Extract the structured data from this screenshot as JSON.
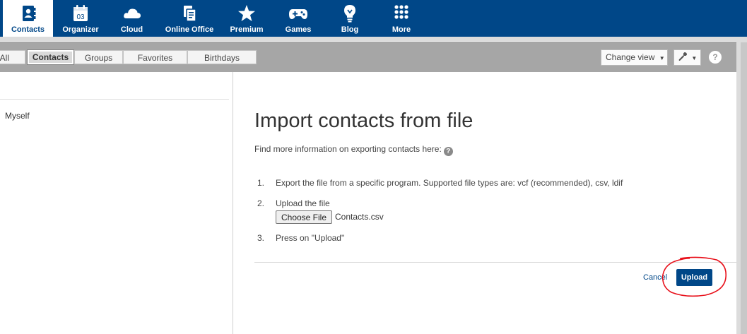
{
  "nav": {
    "items": [
      {
        "label": "Contacts",
        "icon": "contacts-book-icon",
        "active": true
      },
      {
        "label": "Organizer",
        "icon": "calendar-icon",
        "calendar_day": "03"
      },
      {
        "label": "Cloud",
        "icon": "cloud-icon"
      },
      {
        "label": "Online Office",
        "icon": "office-documents-icon"
      },
      {
        "label": "Premium",
        "icon": "star-icon"
      },
      {
        "label": "Games",
        "icon": "gamepad-icon"
      },
      {
        "label": "Blog",
        "icon": "lightbulb-icon"
      },
      {
        "label": "More",
        "icon": "grid-dots-icon"
      }
    ]
  },
  "tabs": {
    "all": "All",
    "contacts": "Contacts",
    "groups": "Groups",
    "favorites": "Favorites",
    "birthdays": "Birthdays"
  },
  "toolbar": {
    "change_view": "Change view",
    "help": "?"
  },
  "sidebar": {
    "myself": "Myself"
  },
  "import": {
    "title": "Import contacts from file",
    "info": "Find more information on exporting contacts here:",
    "steps": [
      {
        "num": "1.",
        "text": "Export the file from a specific program. Supported file types are: vcf (recommended), csv, ldif"
      },
      {
        "num": "2.",
        "text": "Upload the file"
      },
      {
        "num": "3.",
        "text": "Press on \"Upload\""
      }
    ],
    "choose_file_label": "Choose File",
    "file_name": "Contacts.csv",
    "cancel_label": "Cancel",
    "upload_label": "Upload"
  },
  "colors": {
    "brand": "#004788",
    "annotation": "#e8111b"
  }
}
